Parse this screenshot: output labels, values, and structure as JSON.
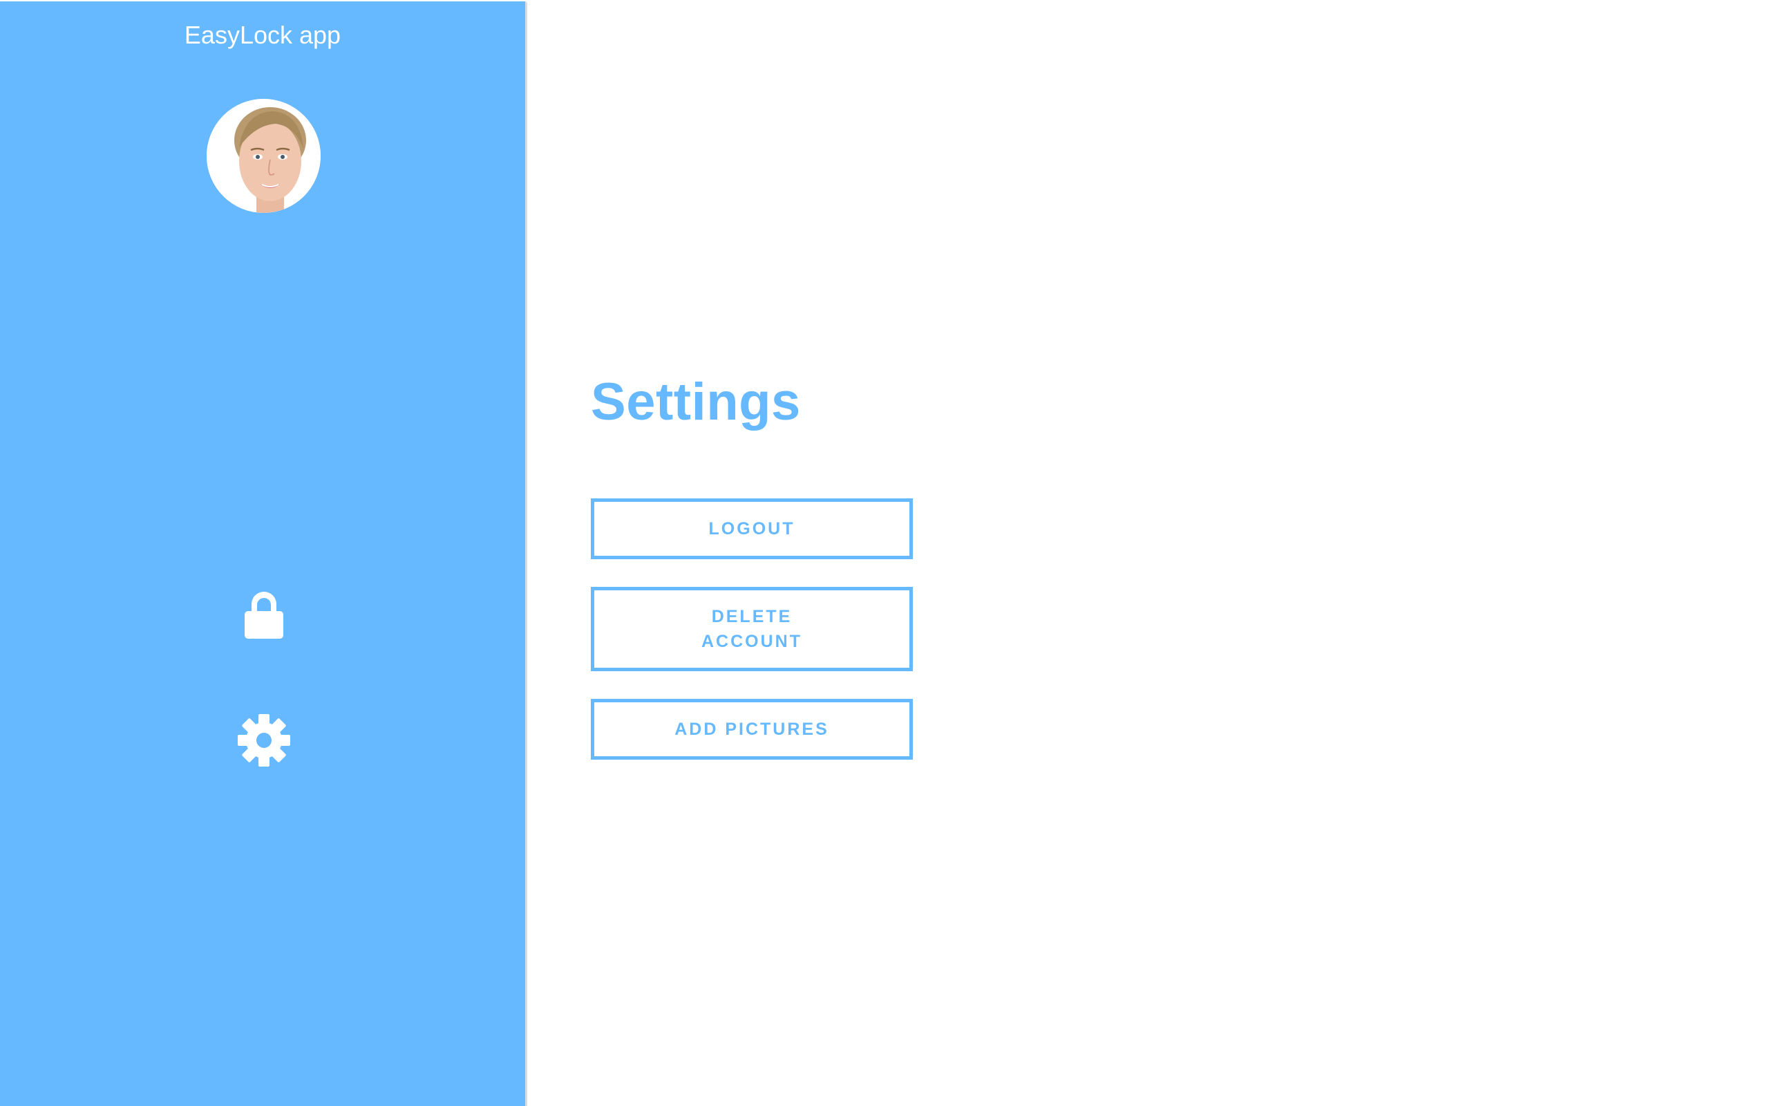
{
  "app": {
    "title": "EasyLock app",
    "accent_color": "#66b9ff",
    "background_color": "#ffffff"
  },
  "sidebar": {
    "avatar_icon": "user-avatar",
    "items": [
      {
        "icon": "lock-icon",
        "active": false
      },
      {
        "icon": "gear-icon",
        "active": true
      }
    ]
  },
  "main": {
    "title": "Settings",
    "buttons": [
      {
        "label": "LOGOUT"
      },
      {
        "label": "DELETE ACCOUNT"
      },
      {
        "label": "ADD PICTURES"
      }
    ]
  }
}
